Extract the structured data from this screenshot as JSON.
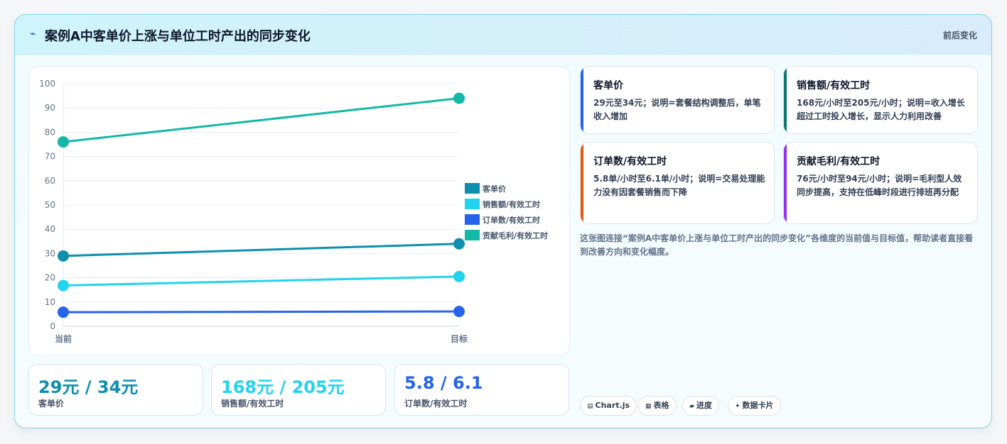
{
  "header": {
    "title": "案例A中客单价上涨与单位工时产出的同步变化",
    "tag": "前后变化"
  },
  "chart_data": {
    "type": "line",
    "categories": [
      "当前",
      "目标"
    ],
    "series": [
      {
        "name": "客单价",
        "values": [
          29,
          34
        ],
        "color": "#0e8fad"
      },
      {
        "name": "销售额/有效工时",
        "values": [
          16.8,
          20.5
        ],
        "color": "#22d3ee"
      },
      {
        "name": "订单数/有效工时",
        "values": [
          5.8,
          6.1
        ],
        "color": "#2563eb"
      },
      {
        "name": "贡献毛利/有效工时",
        "values": [
          76,
          94
        ],
        "color": "#14b8a6"
      }
    ],
    "ylim": [
      0,
      100
    ],
    "yticks": [
      0,
      10,
      20,
      30,
      40,
      50,
      60,
      70,
      80,
      90,
      100
    ],
    "grid": true,
    "legend": "right"
  },
  "stats": [
    {
      "value": "29元 / 34元",
      "label": "客单价",
      "color": "#0e8fad"
    },
    {
      "value": "168元 / 205元",
      "label": "销售额/有效工时",
      "color": "#22d3ee"
    },
    {
      "value": "5.8 / 6.1",
      "label": "订单数/有效工时",
      "color": "#2563eb"
    }
  ],
  "cards": [
    {
      "title": "客单价",
      "text": "29元至34元；说明=套餐结构调整后，单笔收入增加",
      "accent": "#2563eb"
    },
    {
      "title": "销售额/有效工时",
      "text": "168元/小时至205元/小时；说明=收入增长超过工时投入增长，显示人力利用改善",
      "accent": "#0f766e"
    },
    {
      "title": "订单数/有效工时",
      "text": "5.8单/小时至6.1单/小时；说明=交易处理能力没有因套餐销售而下降",
      "accent": "#ea580c"
    },
    {
      "title": "贡献毛利/有效工时",
      "text": "76元/小时至94元/小时；说明=毛利型人效同步提高，支持在低峰时段进行排班再分配",
      "accent": "#9333ea"
    }
  ],
  "description": "这张图连接“案例A中客单价上涨与单位工时产出的同步变化”各维度的当前值与目标值，帮助读者直接看到改善方向和变化幅度。",
  "chips": [
    {
      "icon": "chart-icon",
      "glyph": "▤",
      "label": "Chart.js"
    },
    {
      "icon": "table-icon",
      "glyph": "▦",
      "label": "表格"
    },
    {
      "icon": "progress-icon",
      "glyph": "▰",
      "label": "进度"
    },
    {
      "icon": "spark-icon",
      "glyph": "✦",
      "label": "数据卡片"
    }
  ]
}
